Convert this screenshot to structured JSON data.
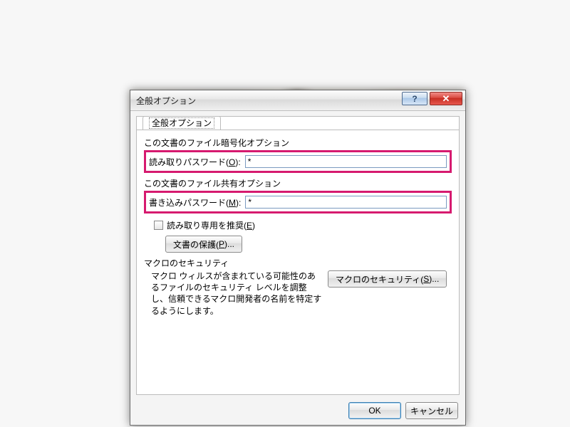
{
  "dialog": {
    "title": "全般オプション",
    "help_glyph": "?",
    "close_glyph": "✕",
    "tab_label": "全般オプション",
    "encrypt_group": "この文書のファイル暗号化オプション",
    "read_pw_label_pre": "読み取りパスワード(",
    "read_pw_key": "O",
    "read_pw_label_post": "):",
    "read_pw_value": "*",
    "share_group": "この文書のファイル共有オプション",
    "write_pw_label_pre": "書き込みパスワード(",
    "write_pw_key": "M",
    "write_pw_label_post": "):",
    "write_pw_value": "*",
    "readonly_label_pre": "読み取り専用を推奨(",
    "readonly_key": "E",
    "readonly_label_post": ")",
    "protect_btn_pre": "文書の保護(",
    "protect_key": "P",
    "protect_btn_post": ")...",
    "macro_heading": "マクロのセキュリティ",
    "macro_text": "マクロ ウィルスが含まれている可能性のあるファイルのセキュリティ レベルを調整し、信頼できるマクロ開発者の名前を特定するようにします。",
    "macro_btn_pre": "マクロのセキュリティ(",
    "macro_key": "S",
    "macro_btn_post": ")...",
    "ok": "OK",
    "cancel": "キャンセル"
  }
}
